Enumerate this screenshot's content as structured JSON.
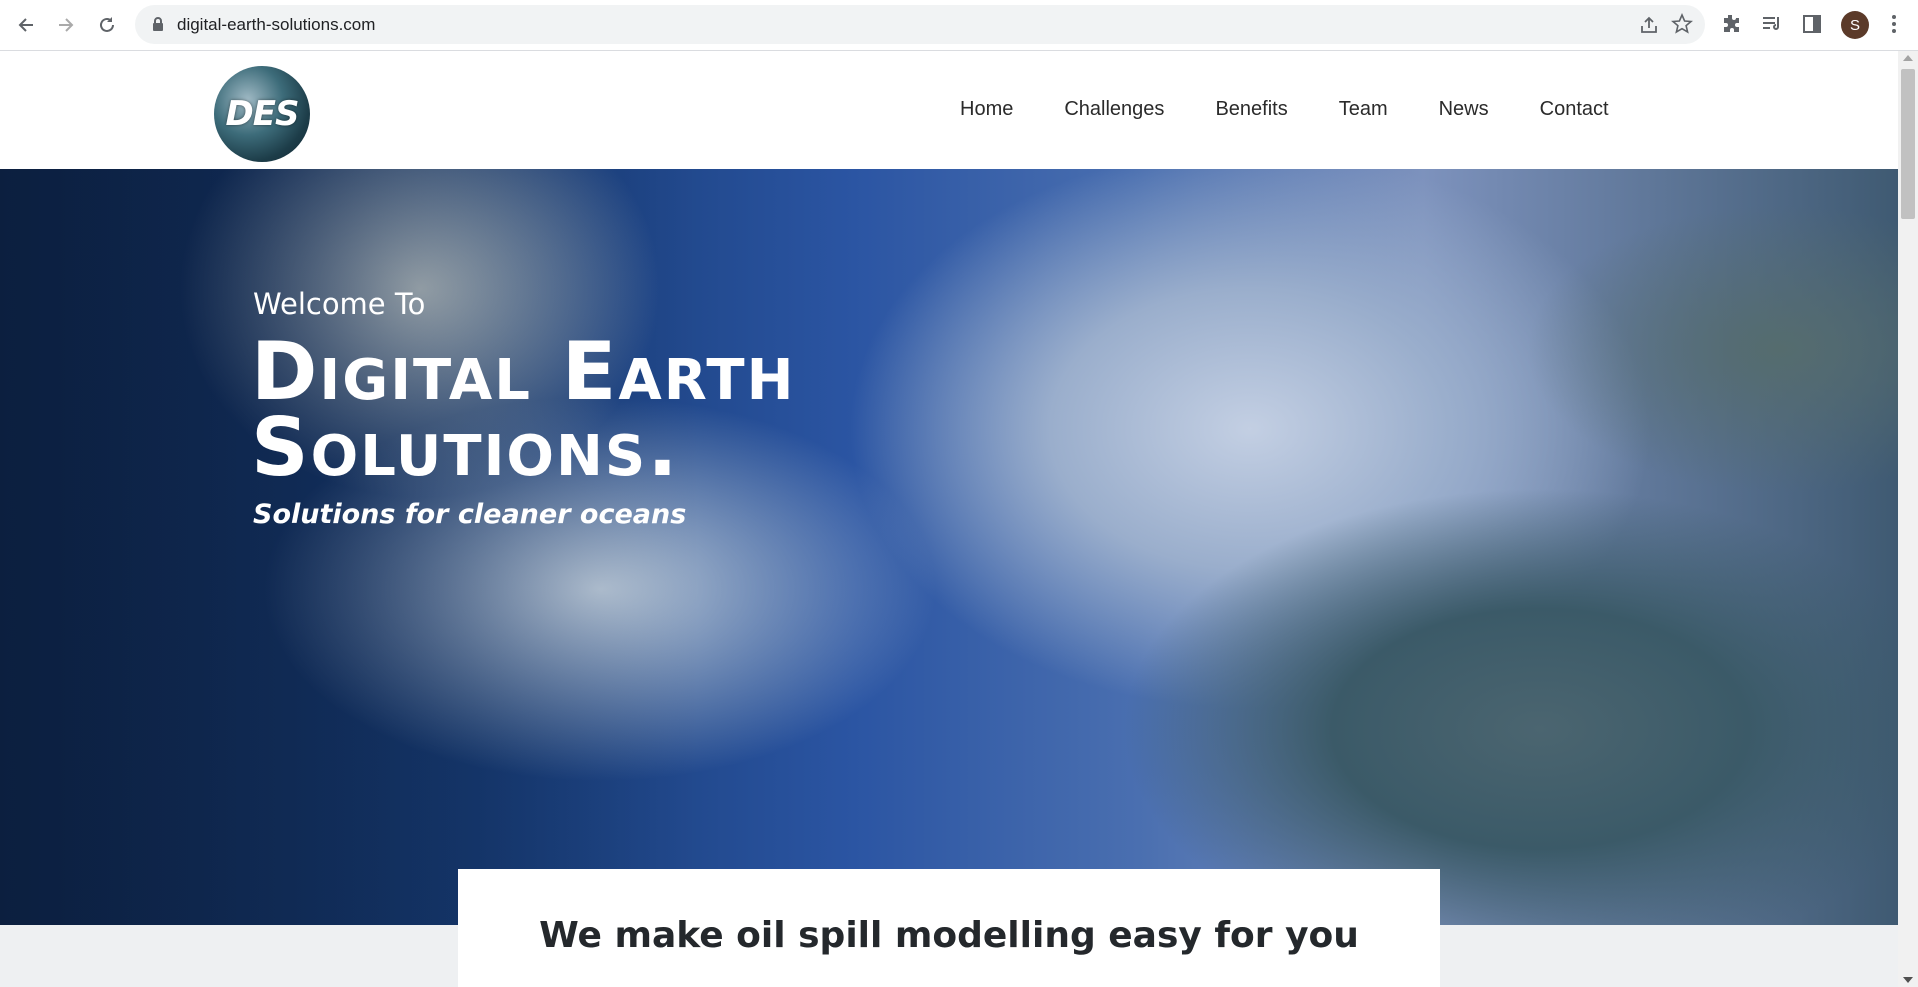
{
  "browser": {
    "url": "digital-earth-solutions.com",
    "profile_initial": "S",
    "icons": [
      "back-icon",
      "forward-icon",
      "reload-icon",
      "lock-icon",
      "share-icon",
      "star-icon",
      "extensions-icon",
      "media-icon",
      "side-panel-icon",
      "menu-icon"
    ]
  },
  "header": {
    "logo_text": "DES",
    "nav": [
      "Home",
      "Challenges",
      "Benefits",
      "Team",
      "News",
      "Contact"
    ]
  },
  "hero": {
    "welcome": "Welcome To",
    "title_line1": "Digital Earth",
    "title_line2": "Solutions.",
    "tagline": "Solutions for cleaner oceans"
  },
  "card": {
    "heading": "We make oil spill modelling easy for you"
  }
}
